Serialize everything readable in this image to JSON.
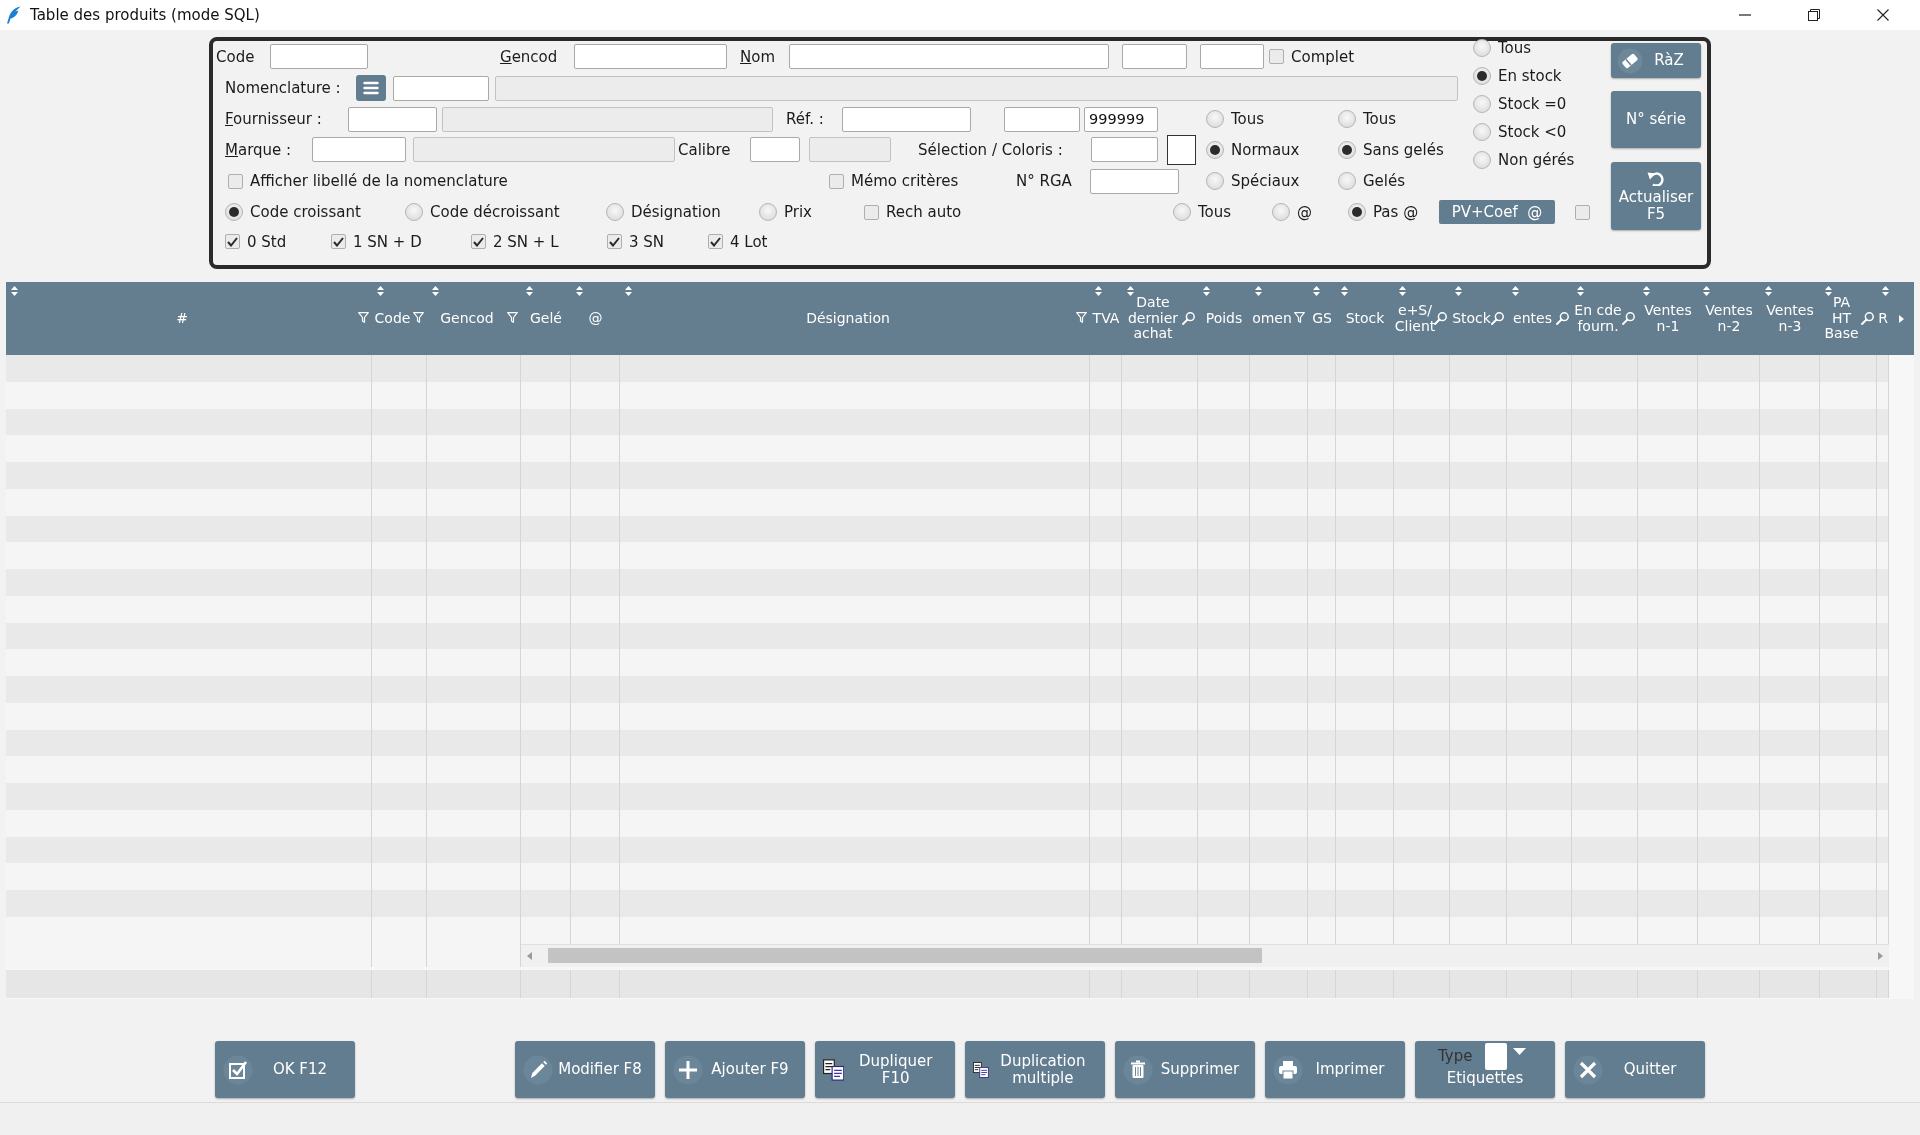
{
  "window": {
    "title": "Table des produits (mode SQL)"
  },
  "search_panel": {
    "rows": [
      [
        {
          "kind": "label",
          "text": "Code",
          "shortcut": false
        },
        {
          "kind": "input",
          "disabled": false
        },
        {
          "kind": "label",
          "text": "Gencod",
          "shortcut": true
        },
        {
          "kind": "input",
          "disabled": false
        },
        {
          "kind": "label",
          "text": "Nom",
          "shortcut": true
        },
        {
          "kind": "input",
          "disabled": false
        },
        {
          "kind": "input",
          "disabled": false
        },
        {
          "kind": "input",
          "disabled": false
        },
        {
          "kind": "checkbox",
          "label": "Complet",
          "checked": false
        }
      ],
      [
        {
          "kind": "label",
          "text": "Nomenclature :",
          "shortcut": false
        },
        {
          "kind": "list-button"
        },
        {
          "kind": "input",
          "disabled": false
        },
        {
          "kind": "input",
          "disabled": true
        }
      ],
      [
        {
          "kind": "label",
          "text": "Fournisseur :",
          "shortcut": true
        },
        {
          "kind": "input",
          "disabled": false
        },
        {
          "kind": "input",
          "disabled": true
        },
        {
          "kind": "label",
          "text": "Réf. :",
          "shortcut": false
        },
        {
          "kind": "input",
          "disabled": false
        },
        {
          "kind": "input",
          "disabled": false
        },
        {
          "kind": "input",
          "disabled": false,
          "value": "999999"
        }
      ],
      [
        {
          "kind": "label",
          "text": "Marque :",
          "shortcut": true
        },
        {
          "kind": "input",
          "disabled": false
        },
        {
          "kind": "input",
          "disabled": true
        },
        {
          "kind": "label",
          "text": "Calibre",
          "shortcut": false
        },
        {
          "kind": "input",
          "disabled": false
        },
        {
          "kind": "input",
          "disabled": true
        },
        {
          "kind": "label",
          "text": "Sélection / Coloris :",
          "shortcut": false
        },
        {
          "kind": "input",
          "disabled": false
        },
        {
          "kind": "swatch"
        }
      ],
      [
        {
          "kind": "checkbox",
          "label": "Afficher libellé de la nomenclature",
          "checked": false
        },
        {
          "kind": "checkbox",
          "label": "Mémo critères",
          "checked": false
        },
        {
          "kind": "label",
          "text": "N° RGA",
          "shortcut": false
        },
        {
          "kind": "input",
          "disabled": false
        }
      ]
    ],
    "type_filter": [
      {
        "label": "Tous",
        "selected": false
      },
      {
        "label": "Normaux",
        "selected": true
      },
      {
        "label": "Spéciaux",
        "selected": false
      }
    ],
    "frozen_filter": [
      {
        "label": "Tous",
        "selected": false
      },
      {
        "label": "Sans gelés",
        "selected": true
      },
      {
        "label": "Gelés",
        "selected": false
      }
    ],
    "stock_filter": [
      {
        "label": "Tous",
        "selected": false
      },
      {
        "label": "En stock",
        "selected": true
      },
      {
        "label": "Stock =0",
        "selected": false
      },
      {
        "label": "Stock <0",
        "selected": false
      },
      {
        "label": "Non gérés",
        "selected": false
      }
    ],
    "options": [
      {
        "kind": "radio",
        "label": "Code croissant",
        "selected": true
      },
      {
        "kind": "radio",
        "label": "Code décroissant",
        "selected": false
      },
      {
        "kind": "radio",
        "label": "Désignation",
        "selected": false
      },
      {
        "kind": "radio",
        "label": "Prix",
        "selected": false
      },
      {
        "kind": "checkbox",
        "label": "Rech auto",
        "checked": false
      },
      {
        "kind": "radio",
        "label": "Tous",
        "selected": false
      },
      {
        "kind": "radio",
        "label": "@",
        "selected": false
      },
      {
        "kind": "radio",
        "label": "Pas @",
        "selected": true
      },
      {
        "kind": "button",
        "label": "PV+Coef  @"
      },
      {
        "kind": "checkbox",
        "checked": false
      }
    ],
    "serial_types": [
      {
        "label": "0 Std",
        "checked": true
      },
      {
        "label": "1 SN + D",
        "checked": true
      },
      {
        "label": "2 SN + L",
        "checked": true
      },
      {
        "label": "3 SN",
        "checked": true
      },
      {
        "label": "4 Lot",
        "checked": true
      }
    ],
    "side_buttons": [
      {
        "kind": "reset",
        "label": "RàZ"
      },
      {
        "kind": "plain",
        "label": "N° série"
      },
      {
        "kind": "refresh",
        "label": "Actualiser F5"
      }
    ]
  },
  "table": {
    "columns": [
      {
        "label": "#",
        "filter": true,
        "search": false
      },
      {
        "label": "Code",
        "filter": true,
        "search": false
      },
      {
        "label": "Gencod",
        "filter": true,
        "search": false
      },
      {
        "label": "Gelé",
        "filter": false,
        "search": false
      },
      {
        "label": "@",
        "filter": false,
        "search": false
      },
      {
        "label": "Désignation",
        "filter": true,
        "search": false
      },
      {
        "label": "TVA",
        "filter": false,
        "search": false
      },
      {
        "label": "Date dernier achat",
        "filter": false,
        "search": true
      },
      {
        "label": "Poids",
        "filter": false,
        "search": false
      },
      {
        "label": "omen",
        "filter": true,
        "search": false
      },
      {
        "label": "GS",
        "filter": false,
        "search": false
      },
      {
        "label": "Stock",
        "filter": false,
        "search": false
      },
      {
        "label": "e+S/ Client",
        "filter": false,
        "search": true
      },
      {
        "label": "Stock",
        "filter": false,
        "search": true
      },
      {
        "label": "entes",
        "filter": false,
        "search": true
      },
      {
        "label": "En cde fourn.",
        "filter": false,
        "search": true
      },
      {
        "label": "Ventes n-1",
        "filter": false,
        "search": false
      },
      {
        "label": "Ventes n-2",
        "filter": false,
        "search": false
      },
      {
        "label": "Ventes n-3",
        "filter": false,
        "search": false
      },
      {
        "label": "PA HT Base",
        "filter": false,
        "search": true
      },
      {
        "label": "R",
        "filter": false,
        "search": false
      }
    ]
  },
  "buttons": [
    {
      "kind": "ok",
      "label": "OK F12"
    },
    {
      "kind": "edit",
      "label": "Modifier F8"
    },
    {
      "kind": "add",
      "label": "Ajouter F9"
    },
    {
      "kind": "duplicate",
      "label": "Dupliquer F10"
    },
    {
      "kind": "duplicate",
      "label": "Duplication multiple"
    },
    {
      "kind": "delete",
      "label": "Supprimer"
    },
    {
      "kind": "print",
      "label": "Imprimer"
    },
    {
      "kind": "label-type",
      "caption": "Type",
      "label": "Etiquettes"
    },
    {
      "kind": "quit",
      "label": "Quitter"
    }
  ]
}
